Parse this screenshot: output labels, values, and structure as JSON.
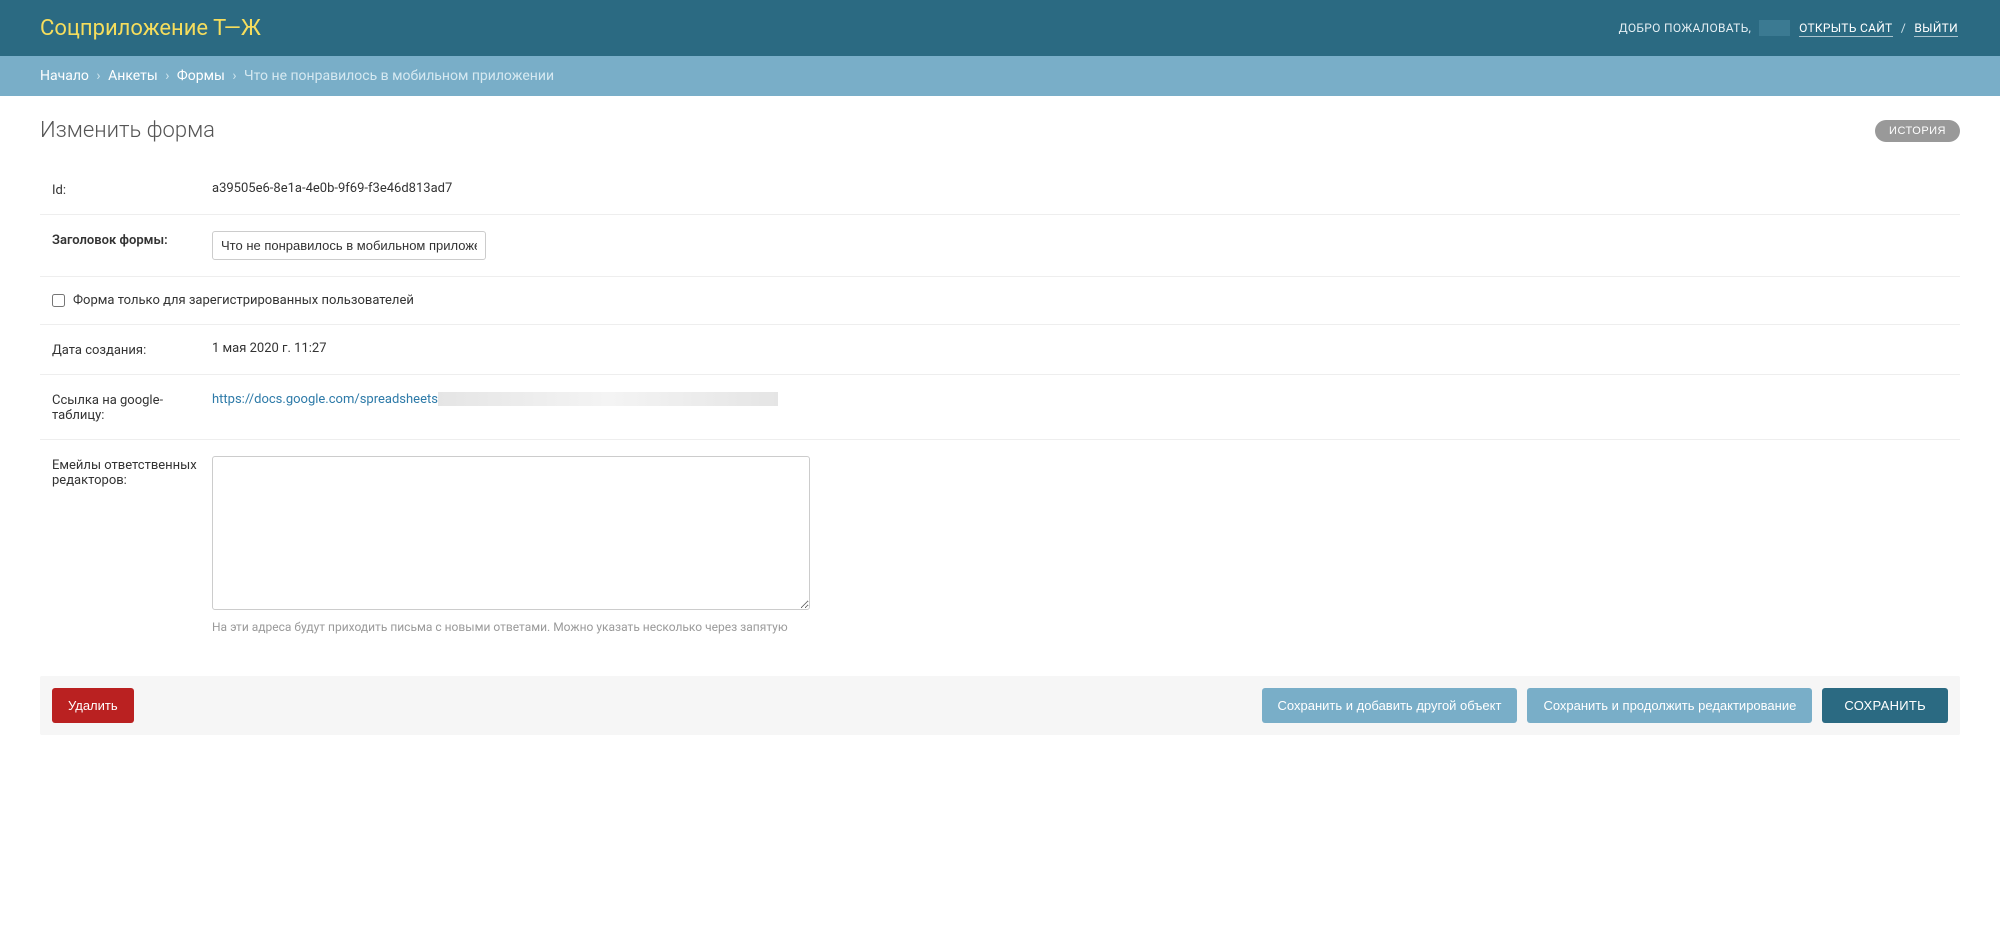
{
  "header": {
    "brand": "Соцприложение Т—Ж",
    "welcome": "ДОБРО ПОЖАЛОВАТЬ,",
    "open_site": "ОТКРЫТЬ САЙТ",
    "logout": "ВЫЙТИ",
    "sep": "/"
  },
  "breadcrumbs": {
    "items": [
      "Начало",
      "Анкеты",
      "Формы"
    ],
    "current": "Что не понравилось в мобильном приложении",
    "divider": "›"
  },
  "page": {
    "title": "Изменить форма",
    "history_btn": "ИСТОРИЯ"
  },
  "fields": {
    "id_label": "Id:",
    "id_value": "a39505e6-8e1a-4e0b-9f69-f3e46d813ad7",
    "title_label": "Заголовок формы:",
    "title_value": "Что не понравилось в мобильном приложении",
    "registered_only_label": "Форма только для зарегистрированных пользователей",
    "created_label": "Дата создания:",
    "created_value": "1 мая 2020 г. 11:27",
    "gsheet_label": "Ссылка на google-таблицу:",
    "gsheet_link_text": "https://docs.google.com/spreadsheets",
    "gsheet_link_href": "https://docs.google.com/spreadsheets",
    "emails_label": "Емейлы ответственных редакторов:",
    "emails_value": "",
    "emails_help": "На эти адреса будут приходить письма с новыми ответами. Можно указать несколько через запятую"
  },
  "buttons": {
    "delete": "Удалить",
    "save_add_another": "Сохранить и добавить другой объект",
    "save_continue": "Сохранить и продолжить редактирование",
    "save": "СОХРАНИТЬ"
  }
}
